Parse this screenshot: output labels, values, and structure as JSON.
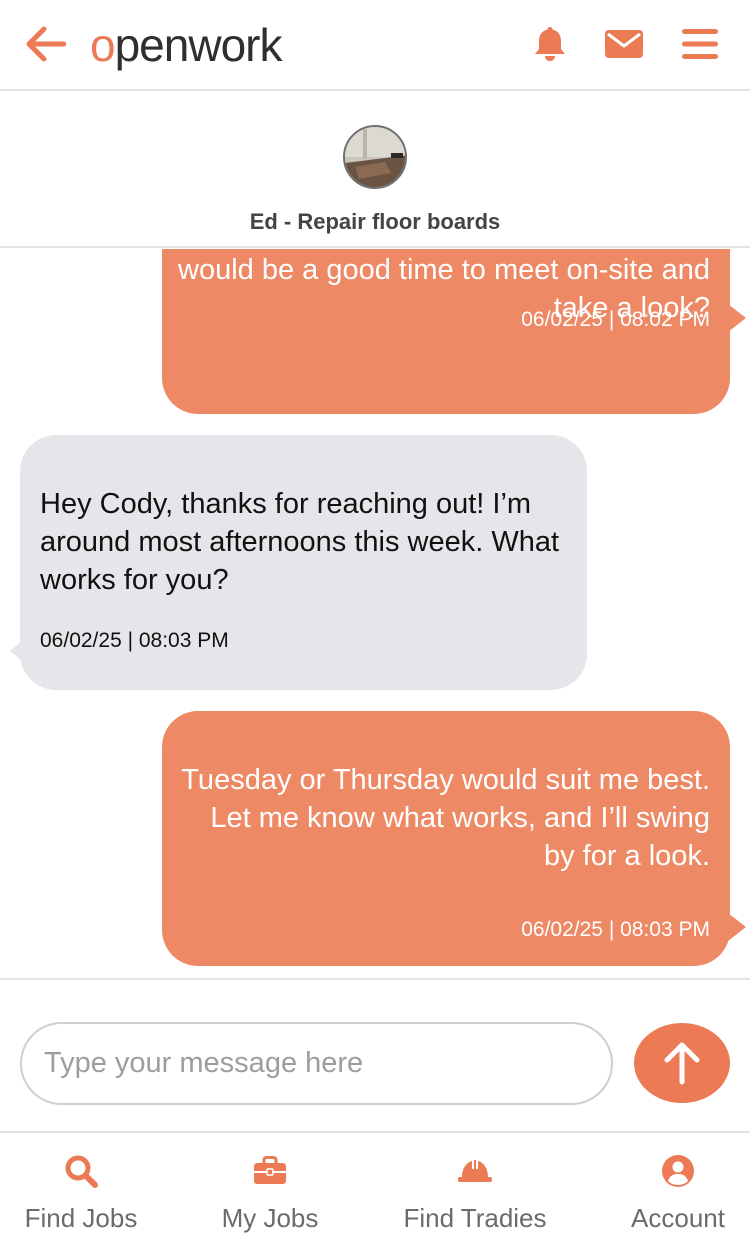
{
  "header": {
    "logo_first": "o",
    "logo_rest": "penwork",
    "icons": [
      "back-arrow-icon",
      "bell-icon",
      "mail-icon",
      "menu-icon"
    ]
  },
  "chat": {
    "title": "Ed - Repair floor boards",
    "messages": [
      {
        "direction": "sent",
        "text": "would be a good time to meet on-site and take a look?",
        "timestamp": "06/02/25 | 08:02 PM"
      },
      {
        "direction": "received",
        "text": "Hey Cody, thanks for reaching out! I’m around most afternoons this week. What works for you?",
        "timestamp": "06/02/25 | 08:03 PM"
      },
      {
        "direction": "sent",
        "text": "Tuesday or Thursday would suit me best. Let me know what works, and I’ll swing by for a look.",
        "timestamp": "06/02/25 | 08:03 PM"
      }
    ]
  },
  "composer": {
    "placeholder": "Type your message here",
    "value": ""
  },
  "nav": [
    {
      "label": "Find Jobs",
      "icon": "search-icon"
    },
    {
      "label": "My Jobs",
      "icon": "briefcase-icon"
    },
    {
      "label": "Find Tradies",
      "icon": "hard-hat-icon"
    },
    {
      "label": "Account",
      "icon": "account-icon"
    }
  ],
  "colors": {
    "accent": "#ec7a55",
    "sent_bubble": "#ee8966",
    "received_bubble": "#e6e6ea"
  }
}
